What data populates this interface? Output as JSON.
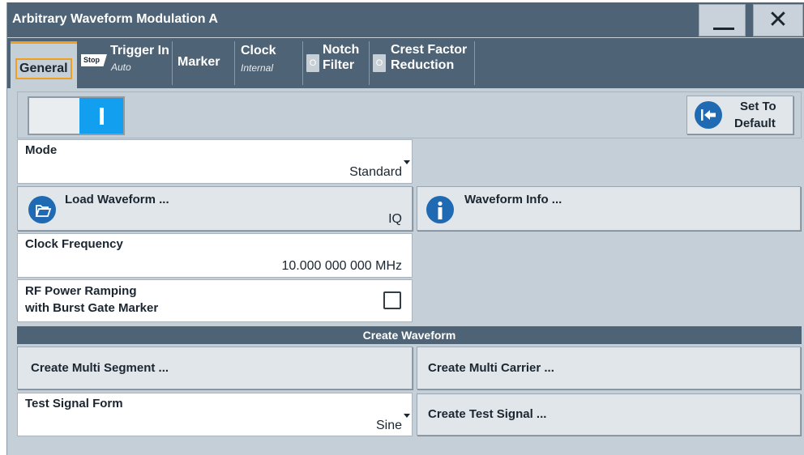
{
  "window": {
    "title": "Arbitrary Waveform Modulation A"
  },
  "tabs": [
    {
      "label": "General"
    },
    {
      "label": "Trigger In",
      "sub": "Auto",
      "badge": "Stop"
    },
    {
      "label": "Marker"
    },
    {
      "label": "Clock",
      "sub": "Internal"
    },
    {
      "label": "Notch\nFilter",
      "line1": "Notch",
      "line2": "Filter",
      "led": "O"
    },
    {
      "label": "Crest Factor\nReduction",
      "line1": "Crest Factor",
      "line2": "Reduction",
      "led": "O"
    }
  ],
  "state_toggle": {
    "on": true
  },
  "set_default": {
    "line1": "Set To",
    "line2": "Default"
  },
  "mode": {
    "label": "Mode",
    "value": "Standard"
  },
  "load_waveform": {
    "label": "Load Waveform ...",
    "value": "IQ"
  },
  "waveform_info": {
    "label": "Waveform Info ..."
  },
  "clock_frequency": {
    "label": "Clock Frequency",
    "value": "10.000 000 000 MHz"
  },
  "rf_power_ramping": {
    "line1": "RF Power Ramping",
    "line2": "with Burst Gate Marker",
    "checked": false
  },
  "create_waveform": {
    "title": "Create Waveform"
  },
  "create_multi_segment": {
    "label": "Create Multi Segment ..."
  },
  "create_multi_carrier": {
    "label": "Create Multi Carrier ..."
  },
  "test_signal_form": {
    "label": "Test Signal Form",
    "value": "Sine"
  },
  "create_test_signal": {
    "label": "Create Test Signal ..."
  },
  "colors": {
    "titlebar": "#4e6375",
    "accent": "#f0a020",
    "toggle_on": "#129ff0",
    "icon_blue": "#1f6ab2",
    "panel_bg": "#c4cfd8"
  }
}
